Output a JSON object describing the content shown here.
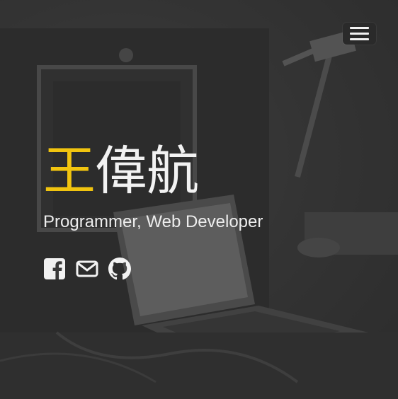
{
  "header": {
    "menu_icon": "hamburger-menu-icon"
  },
  "hero": {
    "name_first": "王",
    "name_rest": "偉航",
    "subtitle": "Programmer, Web Developer",
    "accent_color": "#f1c40f",
    "text_color": "#f2f2f2"
  },
  "social": [
    {
      "icon": "facebook-icon"
    },
    {
      "icon": "email-icon"
    },
    {
      "icon": "github-icon"
    }
  ]
}
